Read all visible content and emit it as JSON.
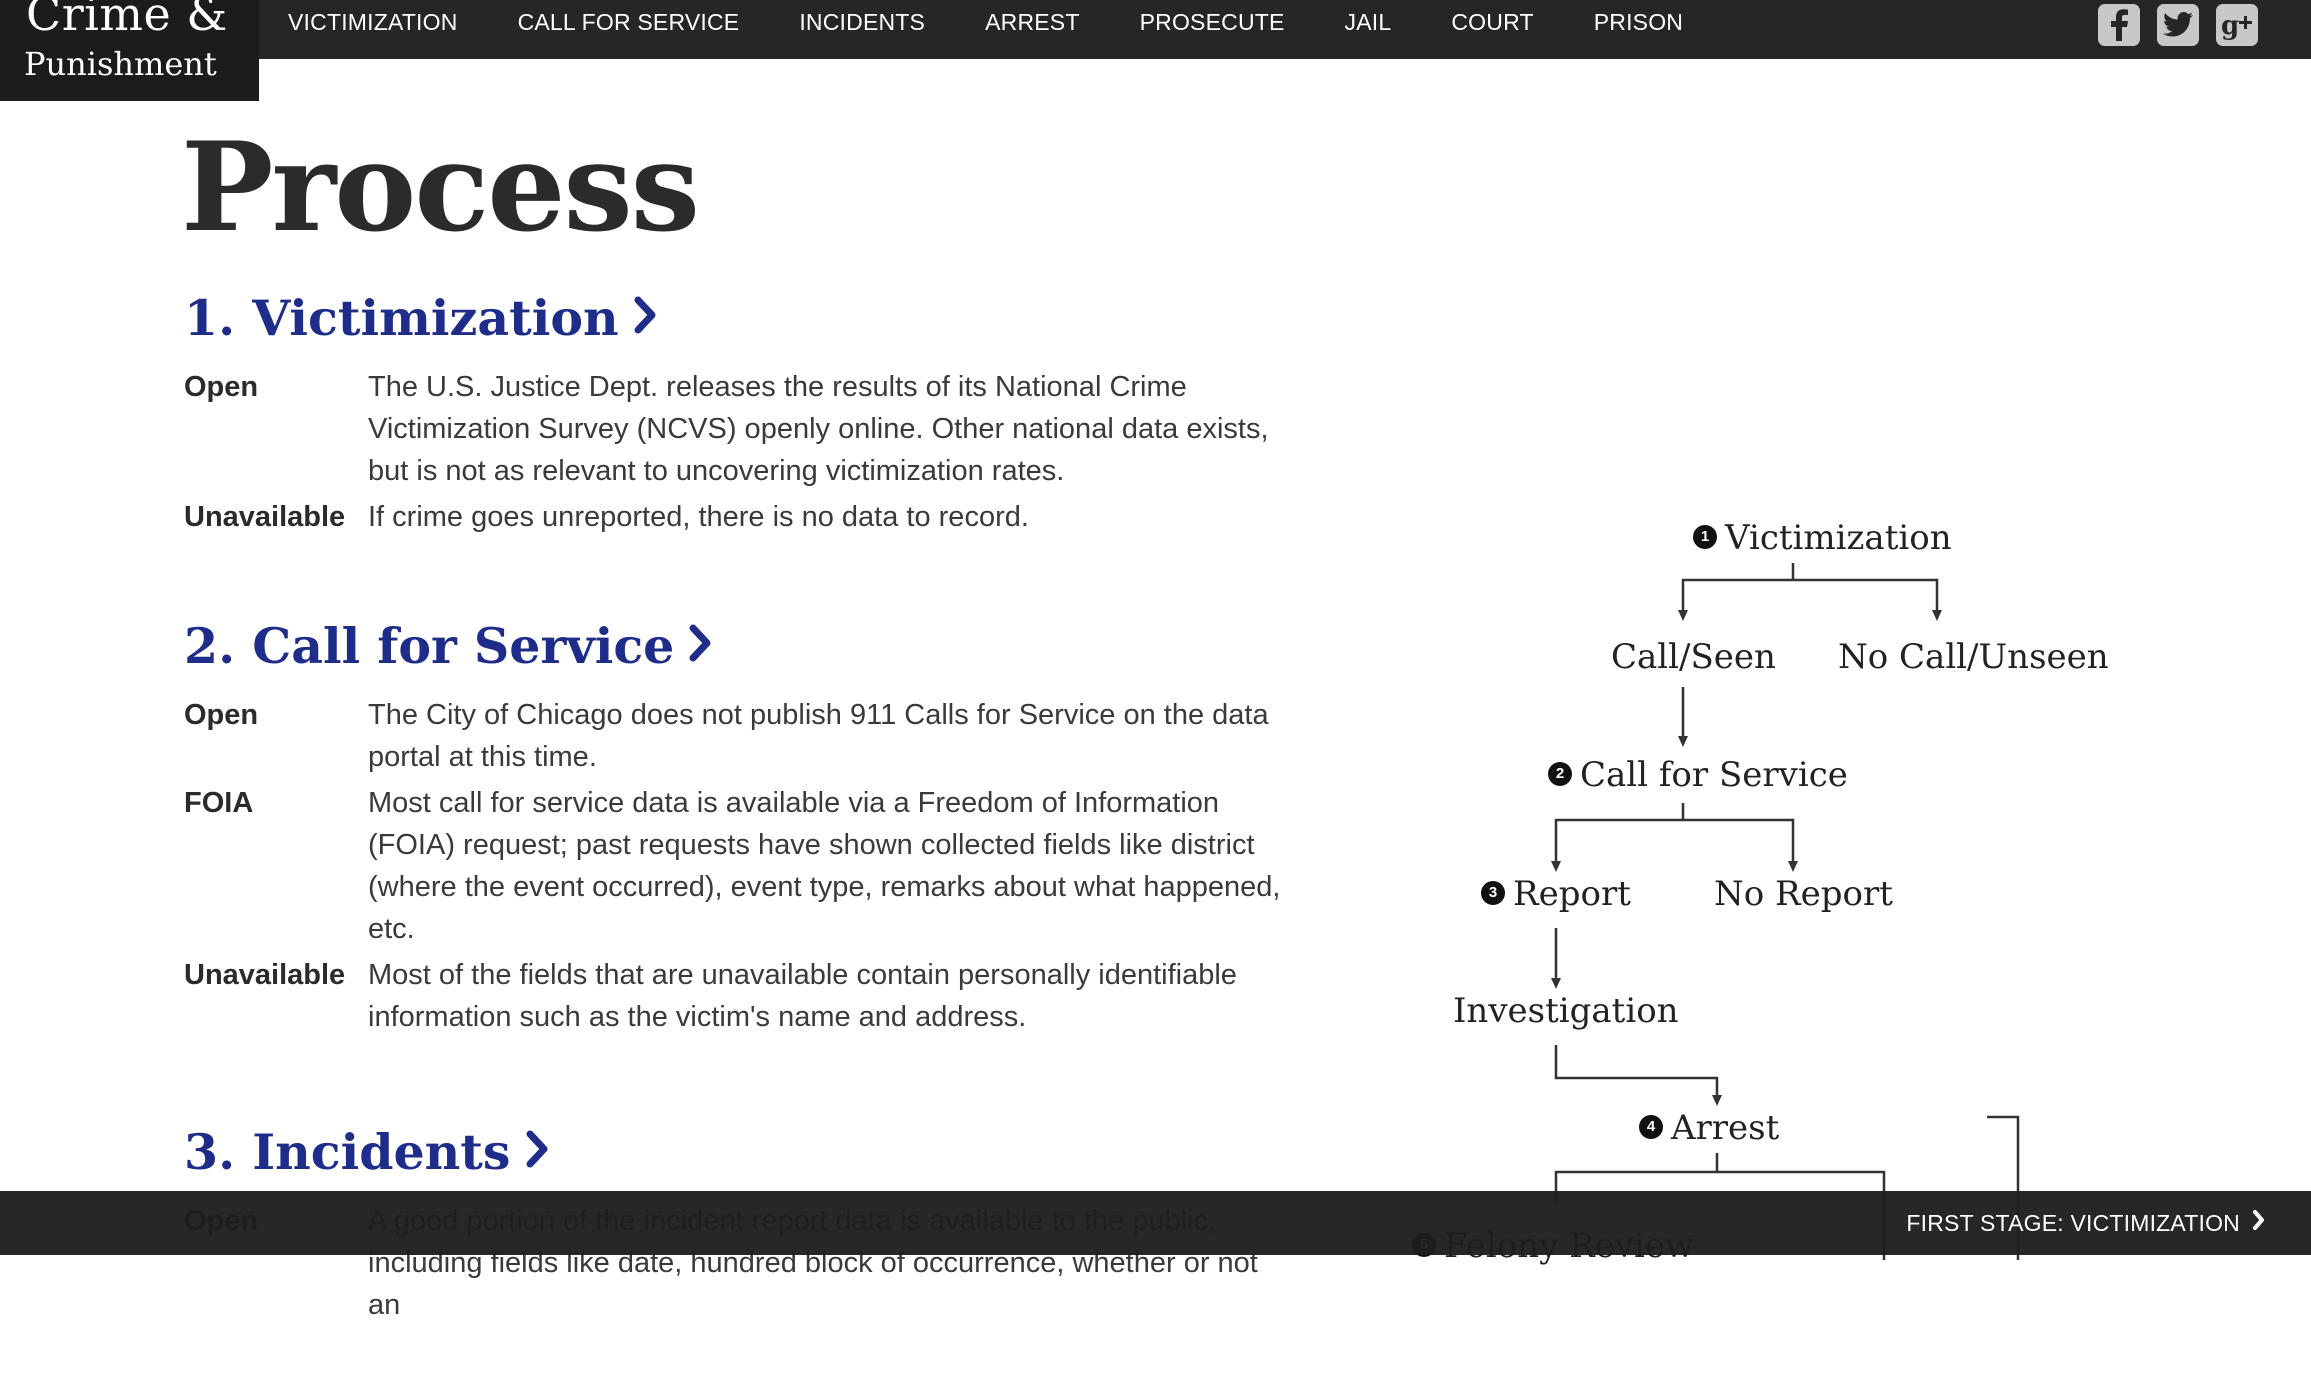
{
  "logo": {
    "line1": "Crime &",
    "line2": "Punishment"
  },
  "nav": {
    "items": [
      "VICTIMIZATION",
      "CALL FOR SERVICE",
      "INCIDENTS",
      "ARREST",
      "PROSECUTE",
      "JAIL",
      "COURT",
      "PRISON"
    ]
  },
  "social": {
    "icons": [
      "facebook-icon",
      "twitter-icon",
      "google-plus-icon"
    ]
  },
  "page_title": "Process",
  "sections": [
    {
      "heading": "1. Victimization",
      "rows": [
        {
          "label": "Open",
          "text": "The U.S. Justice Dept. releases the results of its National Crime Victimization Survey (NCVS) openly online. Other national data exists, but is not as relevant to uncovering victimization rates."
        },
        {
          "label": "Unavailable",
          "text": "If crime goes unreported, there is no data to record."
        }
      ]
    },
    {
      "heading": "2. Call for Service",
      "rows": [
        {
          "label": "Open",
          "text": "The City of Chicago does not publish 911 Calls for Service on the data portal at this time."
        },
        {
          "label": "FOIA",
          "text": "Most call for service data is available via a Freedom of Information (FOIA) request; past requests have shown collected fields like district (where the event occurred), event type, remarks about what happened, etc."
        },
        {
          "label": "Unavailable",
          "text": "Most of the fields that are unavailable contain personally identifiable information such as the victim's name and address."
        }
      ]
    },
    {
      "heading": "3. Incidents",
      "rows": [
        {
          "label": "Open",
          "text": "A good portion of the incident report data is available to the public, including fields like date, hundred block of occurrence, whether or not an"
        }
      ]
    }
  ],
  "flow": {
    "victimization": {
      "num": "1",
      "label": "Victimization"
    },
    "call_seen": "Call/Seen",
    "no_call": "No Call/Unseen",
    "call_for_service": {
      "num": "2",
      "label": "Call for Service"
    },
    "report": {
      "num": "3",
      "label": "Report"
    },
    "no_report": "No Report",
    "investigation": "Investigation",
    "arrest": {
      "num": "4",
      "label": "Arrest"
    },
    "felony_review": {
      "num": "5",
      "label": "Felony Review"
    }
  },
  "footer": {
    "next_stage": "FIRST STAGE: VICTIMIZATION"
  }
}
